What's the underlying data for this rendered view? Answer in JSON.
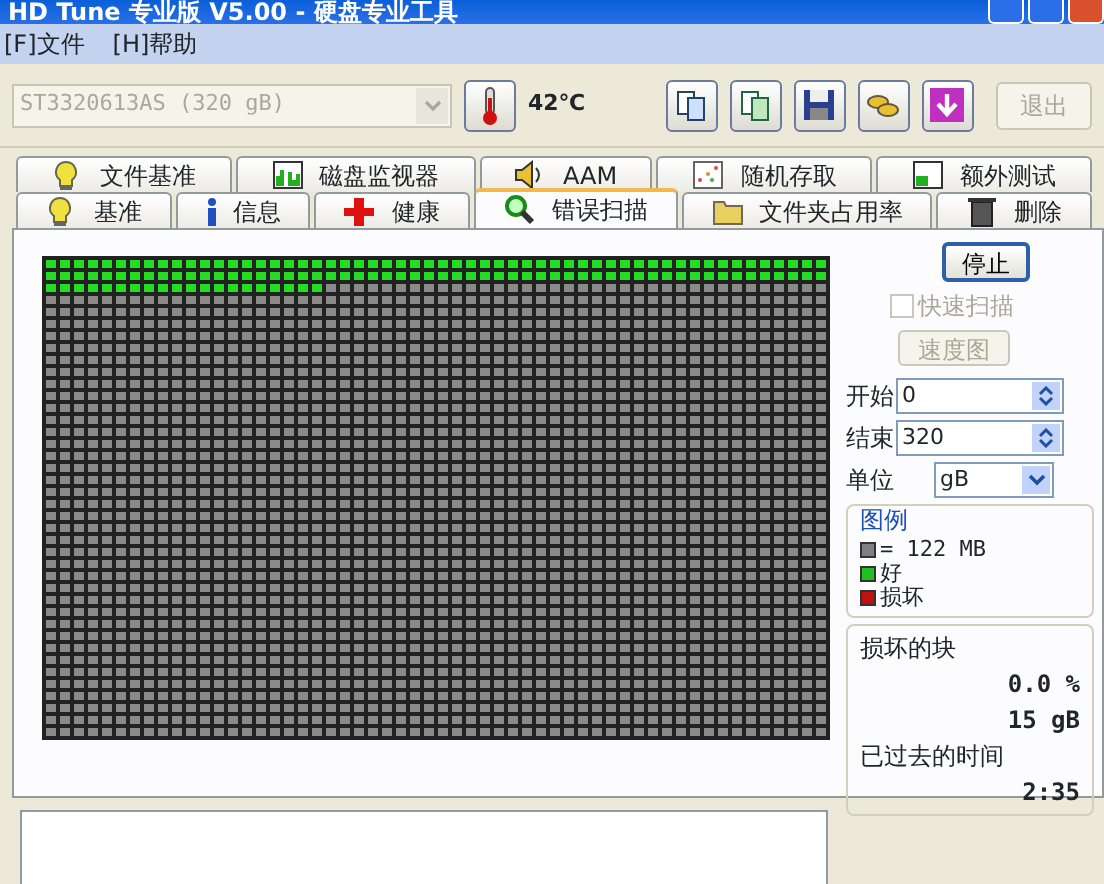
{
  "window": {
    "title": "HD Tune 专业版 V5.00 - 硬盘专业工具"
  },
  "menu": [
    "[F]文件",
    "[H]帮助"
  ],
  "toolbar": {
    "drive": {
      "value": "ST3320613AS (320 gB)",
      "disabled": true
    },
    "temperature": "42℃",
    "exit": {
      "label": "退出",
      "disabled": true
    }
  },
  "tab_rows": [
    [
      {
        "label": "文件基准",
        "kind": "bulb",
        "selected": false
      },
      {
        "label": "磁盘监视器",
        "kind": "monitor",
        "selected": false
      },
      {
        "label": "AAM",
        "kind": "speaker",
        "selected": false
      },
      {
        "label": "随机存取",
        "kind": "scatter",
        "selected": false
      },
      {
        "label": "额外测试",
        "kind": "window",
        "selected": false
      }
    ],
    [
      {
        "label": "基准",
        "kind": "bulb",
        "selected": false
      },
      {
        "label": "信息",
        "kind": "info",
        "selected": false
      },
      {
        "label": "健康",
        "kind": "cross",
        "selected": false
      },
      {
        "label": "错误扫描",
        "kind": "search",
        "selected": true
      },
      {
        "label": "文件夹占用率",
        "kind": "folder",
        "selected": false
      },
      {
        "label": "删除",
        "kind": "trash",
        "selected": false
      }
    ]
  ],
  "scan_map": {
    "level": 0.059
  },
  "controls": {
    "stop": "停止",
    "quick_scan": {
      "label": "快速扫描",
      "checked": false,
      "disabled": true
    },
    "speed_map": {
      "label": "速度图",
      "disabled": true
    },
    "start": {
      "label": "开始",
      "value": "0"
    },
    "end": {
      "label": "结束",
      "value": "320"
    },
    "unit": {
      "label": "单位",
      "value": "gB"
    }
  },
  "legend": {
    "title": "图例",
    "items": [
      {
        "label": "= 122 MB",
        "color": "#808080"
      },
      {
        "label": "好",
        "color": "#20c020"
      },
      {
        "label": "损坏",
        "color": "#c01010"
      }
    ]
  },
  "stats": [
    {
      "label": "损坏的块",
      "value": "0.0 %"
    },
    {
      "value": "15 gB"
    },
    {
      "label": "已过去的时间",
      "value": "2:35"
    }
  ]
}
